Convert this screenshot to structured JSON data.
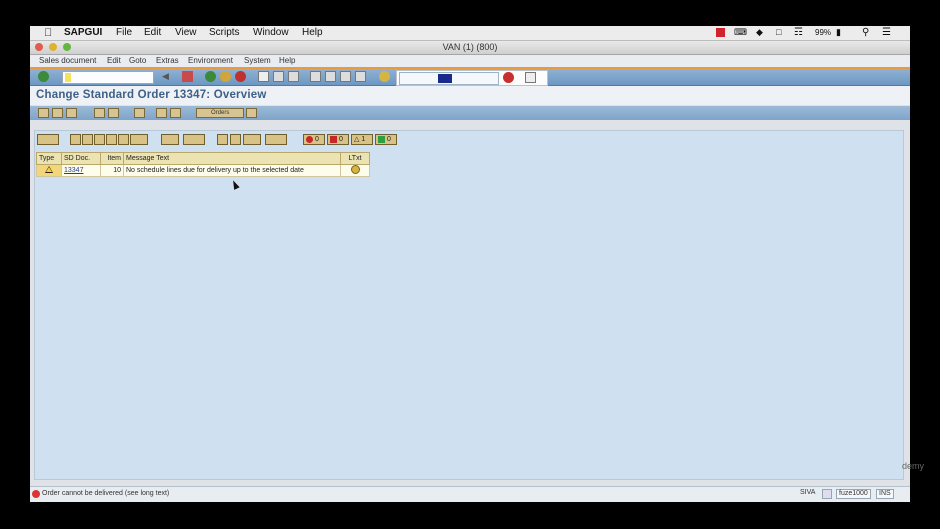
{
  "mac_menu": {
    "app": "SAPGUI",
    "items": [
      "File",
      "Edit",
      "View",
      "Scripts",
      "Window",
      "Help"
    ],
    "battery": "99%"
  },
  "window": {
    "title": "VAN (1) (800)"
  },
  "sap_menu": {
    "items": [
      "Sales document",
      "Edit",
      "Goto",
      "Extras",
      "Environment",
      "System",
      "Help"
    ]
  },
  "page": {
    "title": "Change Standard Order 13347: Overview"
  },
  "app_toolbar": {
    "orders_label": "Orders"
  },
  "alv_counts": {
    "error_red": "0",
    "stop_red": "0",
    "warning": "1",
    "success": "0"
  },
  "log_table": {
    "headers": [
      "Type",
      "SD Doc.",
      "Item",
      "Message Text",
      "LTxt"
    ],
    "rows": [
      {
        "type": "warning",
        "sd_doc": "13347",
        "item": "10",
        "message": "No schedule lines due for delivery up to the selected date"
      }
    ]
  },
  "status_bar": {
    "message": "Order cannot be delivered (see long text)",
    "user": "SIVA",
    "server": "fuze1000",
    "mode": "INS"
  },
  "watermark": "demy",
  "colors": {
    "accent_orange": "#e99a3e",
    "title_blue": "#3e5f86",
    "toolbar_blue": "#7ea4c9"
  }
}
